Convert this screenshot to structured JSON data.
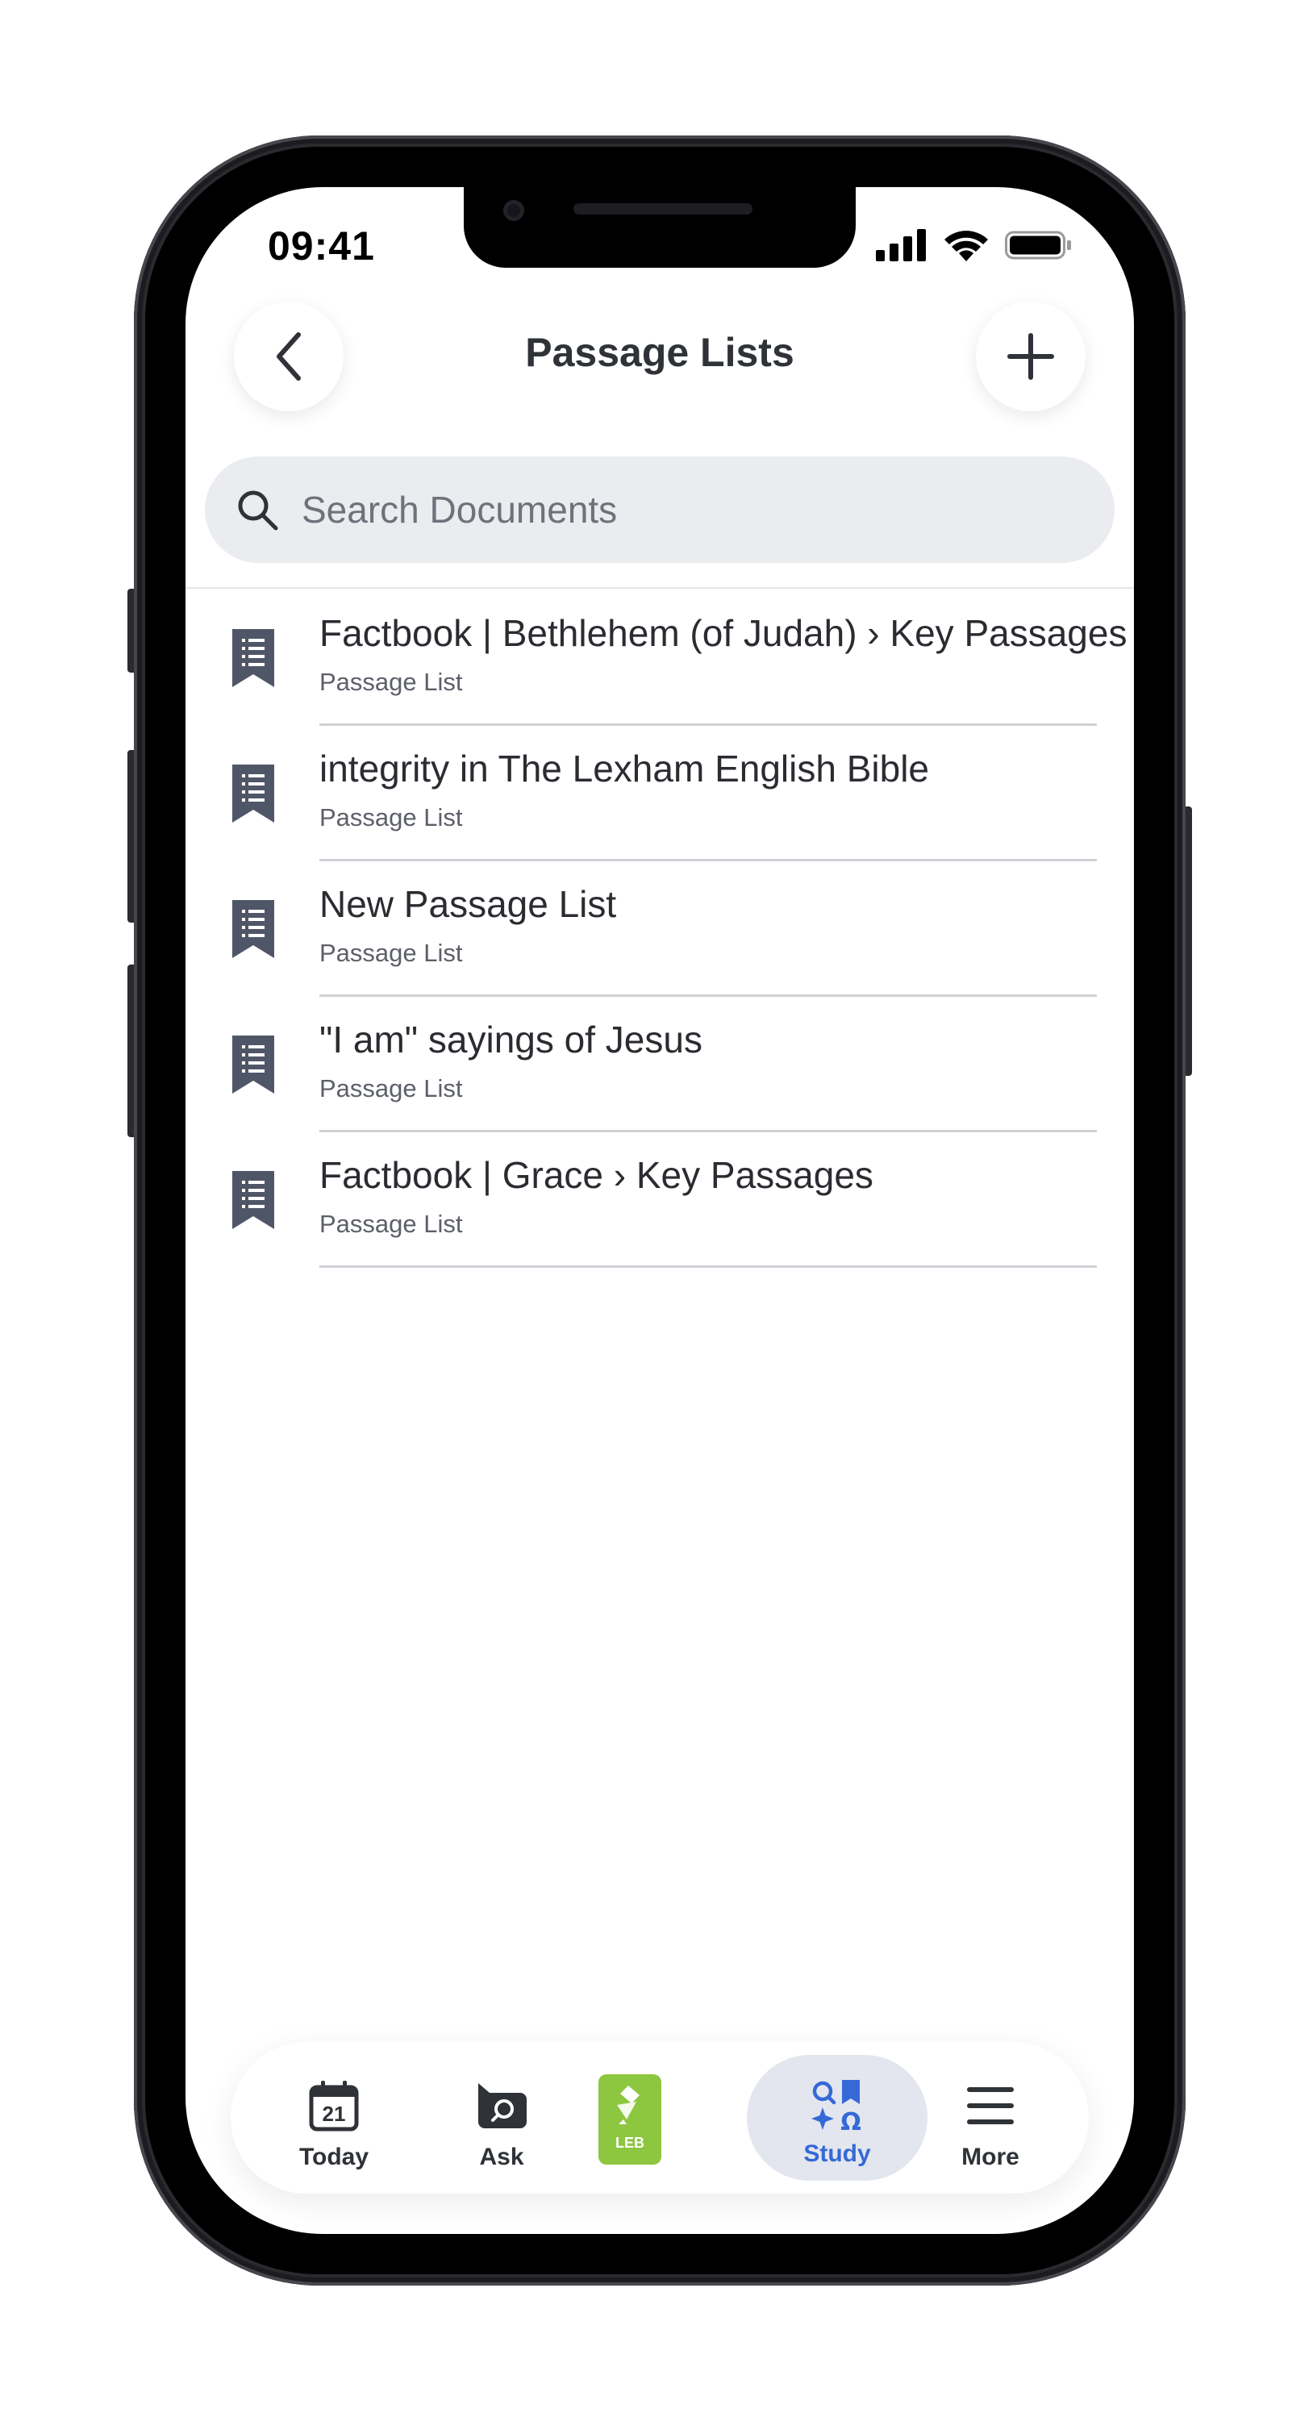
{
  "status_bar": {
    "time": "09:41"
  },
  "header": {
    "title": "Passage Lists"
  },
  "search": {
    "placeholder": "Search Documents",
    "value": ""
  },
  "list": {
    "items": [
      {
        "title": "Factbook | Bethlehem (of Judah) › Key Passages",
        "subtitle": "Passage List"
      },
      {
        "title": "integrity in The Lexham English Bible",
        "subtitle": "Passage List"
      },
      {
        "title": "New Passage List",
        "subtitle": "Passage List"
      },
      {
        "title": "\"I am\" sayings of Jesus",
        "subtitle": "Passage List"
      },
      {
        "title": "Factbook | Grace › Key Passages",
        "subtitle": "Passage List"
      }
    ]
  },
  "tabbar": {
    "tabs": [
      {
        "label": "Today",
        "icon": "calendar-icon",
        "calendar_day": "21"
      },
      {
        "label": "Ask",
        "icon": "chat-search-icon"
      },
      {
        "label": "LEB",
        "icon": "bible-book-icon"
      },
      {
        "label": "Study",
        "icon": "study-icon",
        "active": true
      },
      {
        "label": "More",
        "icon": "menu-icon"
      }
    ]
  },
  "colors": {
    "accent": "#3569d6",
    "icon_slate": "#4f5667",
    "leb_green": "#8dc63f",
    "search_bg": "#ebecf0"
  }
}
